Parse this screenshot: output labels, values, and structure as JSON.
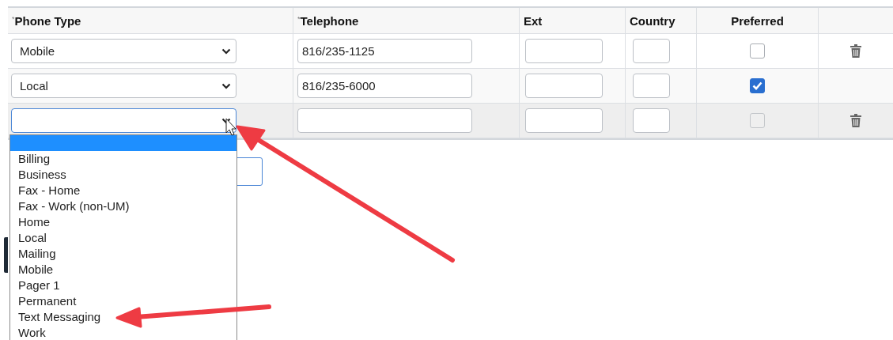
{
  "table": {
    "columns": [
      {
        "label": "Phone Type",
        "marker": "*"
      },
      {
        "label": "Telephone",
        "marker": "*"
      },
      {
        "label": "Ext"
      },
      {
        "label": "Country"
      },
      {
        "label": "Preferred"
      }
    ],
    "rows": [
      {
        "phone_type": "Mobile",
        "telephone": "816/235-1125",
        "preferred": {
          "checked": false,
          "disabled": false
        },
        "deletable": true,
        "active": false
      },
      {
        "phone_type": "Local",
        "telephone": "816/235-6000",
        "preferred": {
          "checked": true,
          "disabled": false
        },
        "deletable": false,
        "active": false
      },
      {
        "preferred": {
          "checked": false,
          "disabled": true
        },
        "deletable": true,
        "active": true
      }
    ]
  },
  "dropdown": {
    "open": true,
    "options": [
      {
        "selected": true
      },
      {
        "label": "Billing",
        "selected": false
      },
      {
        "label": "Business",
        "selected": false
      },
      {
        "label": "Fax - Home",
        "selected": false
      },
      {
        "label": "Fax - Work (non-UM)",
        "selected": false
      },
      {
        "label": "Home",
        "selected": false
      },
      {
        "label": "Local",
        "selected": false
      },
      {
        "label": "Mailing",
        "selected": false
      },
      {
        "label": "Mobile",
        "selected": false
      },
      {
        "label": "Pager 1",
        "selected": false
      },
      {
        "label": "Permanent",
        "selected": false
      },
      {
        "label": "Text Messaging",
        "selected": false
      },
      {
        "label": "Work",
        "selected": false
      }
    ]
  }
}
